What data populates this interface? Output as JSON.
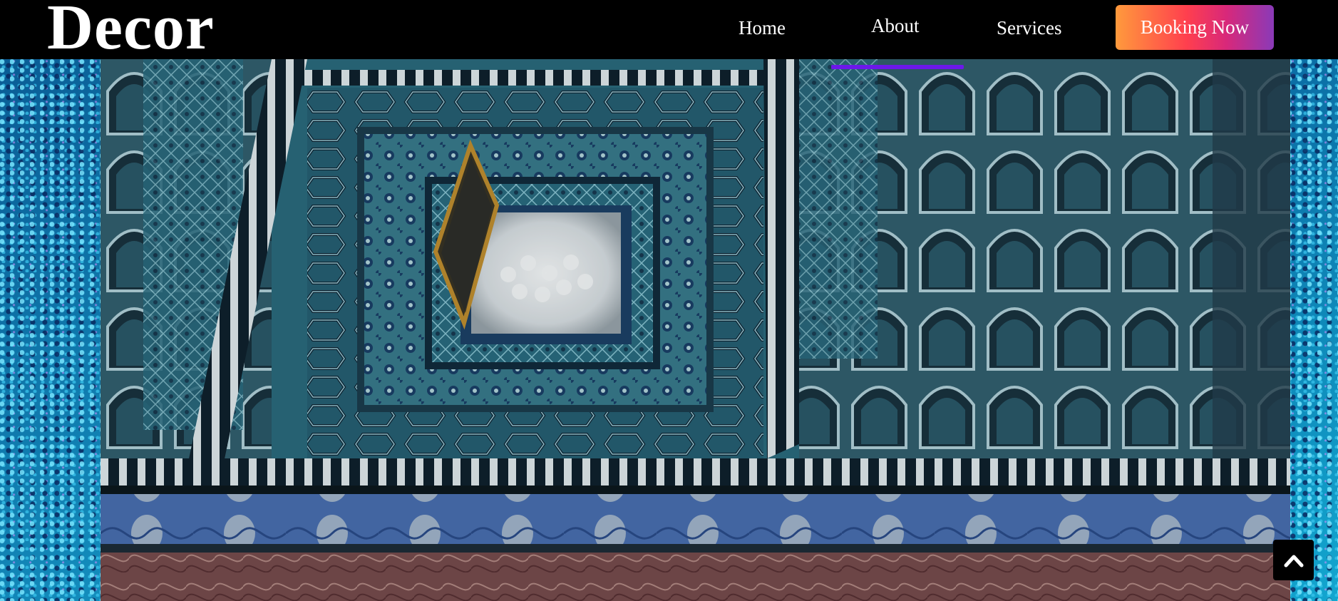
{
  "brand": {
    "logo_text": "Decor"
  },
  "nav": {
    "items": [
      {
        "label": "Home",
        "active": false
      },
      {
        "label": "About",
        "active": true
      },
      {
        "label": "Services",
        "active": false
      }
    ],
    "cta_label": "Booking Now"
  },
  "colors": {
    "navbar_bg": "#000000",
    "active_indicator": "#6c18ea",
    "cta_gradient_start": "#ff9a3c",
    "cta_gradient_end": "#8a3ab8",
    "side_texture": "#0d7fa8"
  },
  "icons": {
    "scroll_top": "chevron-up-icon"
  }
}
